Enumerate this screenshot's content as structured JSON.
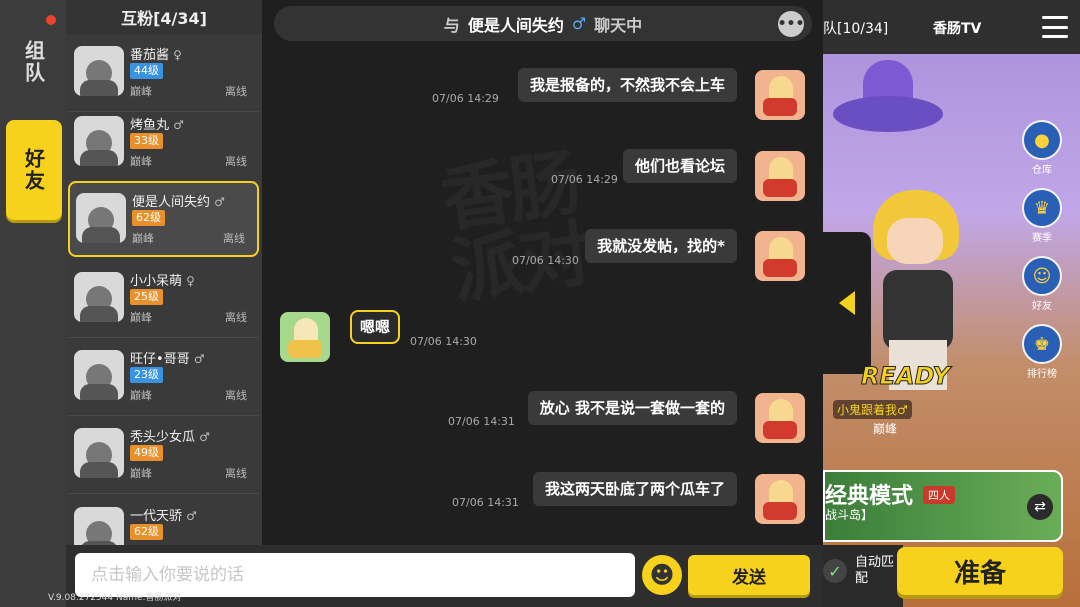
{
  "tabs": {
    "team": "组队",
    "friends": "好友"
  },
  "friend_list": {
    "title": "互粉[4/34]",
    "items": [
      {
        "name": "番茄酱",
        "gender": "♀",
        "level": "44级",
        "level_color": "#3a93e0",
        "rank": "巅峰",
        "status": "离线"
      },
      {
        "name": "烤鱼丸",
        "gender": "♂",
        "level": "33级",
        "level_color": "#e8902c",
        "rank": "巅峰",
        "status": "离线"
      },
      {
        "name": "便是人间失约",
        "gender": "♂",
        "level": "62级",
        "level_color": "#e8902c",
        "rank": "巅峰",
        "status": "离线",
        "selected": true
      },
      {
        "name": "小小呆萌",
        "gender": "♀",
        "level": "25级",
        "level_color": "#e8902c",
        "rank": "巅峰",
        "status": "离线"
      },
      {
        "name": "旺仔•哥哥",
        "gender": "♂",
        "level": "23级",
        "level_color": "#3a93e0",
        "rank": "巅峰",
        "status": "离线"
      },
      {
        "name": "秃头少女瓜",
        "gender": "♂",
        "level": "49级",
        "level_color": "#e8902c",
        "rank": "巅峰",
        "status": "离线"
      },
      {
        "name": "一代天骄",
        "gender": "♂",
        "level": "62级",
        "level_color": "#e8902c",
        "rank": "",
        "status": ""
      }
    ]
  },
  "chat": {
    "header_prefix": "与",
    "header_name": "便是人间失约",
    "header_gender": "♂",
    "header_suffix": "聊天中",
    "more_label": "•••",
    "watermark": "香肠派对",
    "messages": [
      {
        "side": "right",
        "text": "我是报备的，不然我不会上车",
        "time": "07/06 14:29"
      },
      {
        "side": "right",
        "text": "他们也看论坛",
        "time": "07/06 14:29"
      },
      {
        "side": "right",
        "text": "我就没发帖，找的*",
        "time": "07/06 14:30"
      },
      {
        "side": "left",
        "text": "嗯嗯",
        "time": "07/06 14:30"
      },
      {
        "side": "right",
        "text": "放心 我不是说一套做一套的",
        "time": "07/06 14:31"
      },
      {
        "side": "right",
        "text": "我这两天卧底了两个瓜车了",
        "time": "07/06 14:31"
      }
    ]
  },
  "input": {
    "placeholder": "点击输入你要说的话",
    "emoji": "☻",
    "send_label": "发送"
  },
  "version_text": "V.9.08.272544 Name:香肠派对",
  "game": {
    "team_label": "队[10/34]",
    "tv_label": "香肠TV",
    "icons": [
      {
        "label": "仓库",
        "glyph": "●"
      },
      {
        "label": "赛季",
        "glyph": "♛"
      },
      {
        "label": "好友",
        "glyph": "☺"
      },
      {
        "label": "排行榜",
        "glyph": "♚"
      }
    ],
    "ready_status": "READY",
    "leader_line": "小鬼跟着我♂",
    "leader_rank": "巅峰",
    "mode_title": "经典模式",
    "mode_badge": "四人",
    "mode_sub": "战斗岛】",
    "swap_glyph": "⇄",
    "auto_label": "自动匹配",
    "auto_check": "✓",
    "ready_button": "准备"
  }
}
